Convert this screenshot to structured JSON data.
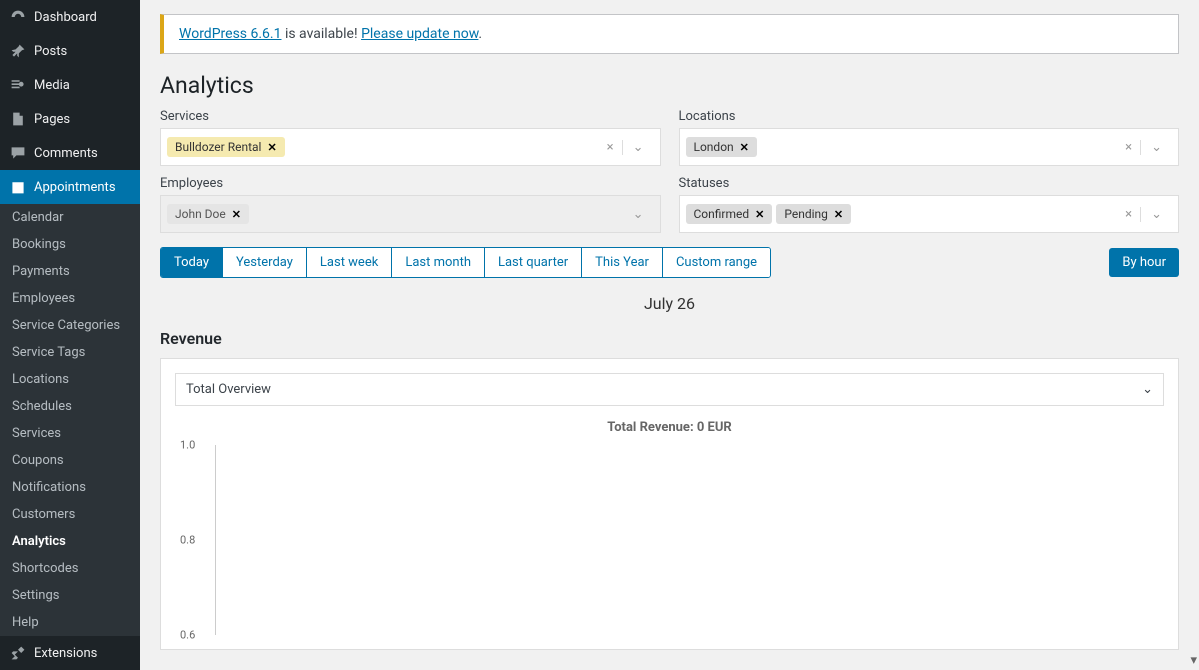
{
  "nav": {
    "main": [
      {
        "icon": "dashboard",
        "label": "Dashboard"
      },
      {
        "icon": "pin",
        "label": "Posts"
      },
      {
        "icon": "media",
        "label": "Media"
      },
      {
        "icon": "page",
        "label": "Pages"
      },
      {
        "icon": "comment",
        "label": "Comments"
      },
      {
        "icon": "calendar",
        "label": "Appointments",
        "active": true
      }
    ],
    "sub": [
      "Calendar",
      "Bookings",
      "Payments",
      "Employees",
      "Service Categories",
      "Service Tags",
      "Locations",
      "Schedules",
      "Services",
      "Coupons",
      "Notifications",
      "Customers",
      "Analytics",
      "Shortcodes",
      "Settings",
      "Help"
    ],
    "sub_active": "Analytics",
    "extensions": {
      "icon": "tools",
      "label": "Extensions"
    }
  },
  "notice": {
    "link1": "WordPress 6.6.1",
    "text": " is available! ",
    "link2": "Please update now"
  },
  "page_title": "Analytics",
  "filters": {
    "services": {
      "label": "Services",
      "chips": [
        {
          "text": "Bulldozer Rental",
          "style": "yellow"
        }
      ]
    },
    "locations": {
      "label": "Locations",
      "chips": [
        {
          "text": "London",
          "style": "gray-dark"
        }
      ]
    },
    "employees": {
      "label": "Employees",
      "chips": [
        {
          "text": "John Doe",
          "style": "gray"
        }
      ],
      "disabled": true
    },
    "statuses": {
      "label": "Statuses",
      "chips": [
        {
          "text": "Confirmed",
          "style": "gray-dark"
        },
        {
          "text": "Pending",
          "style": "gray-dark"
        }
      ]
    }
  },
  "ranges": [
    "Today",
    "Yesterday",
    "Last week",
    "Last month",
    "Last quarter",
    "This Year",
    "Custom range"
  ],
  "range_active": "Today",
  "by_hour": "By hour",
  "date_label": "July 26",
  "revenue": {
    "heading": "Revenue",
    "dropdown": "Total Overview",
    "chart_title": "Total Revenue: 0 EUR"
  },
  "chart_data": {
    "type": "line",
    "title": "Total Revenue: 0 EUR",
    "xlabel": "",
    "ylabel": "",
    "ylim": [
      0.6,
      1.0
    ],
    "yticks": [
      1.0,
      0.8,
      0.6
    ],
    "series": [
      {
        "name": "Revenue",
        "values": []
      }
    ]
  }
}
